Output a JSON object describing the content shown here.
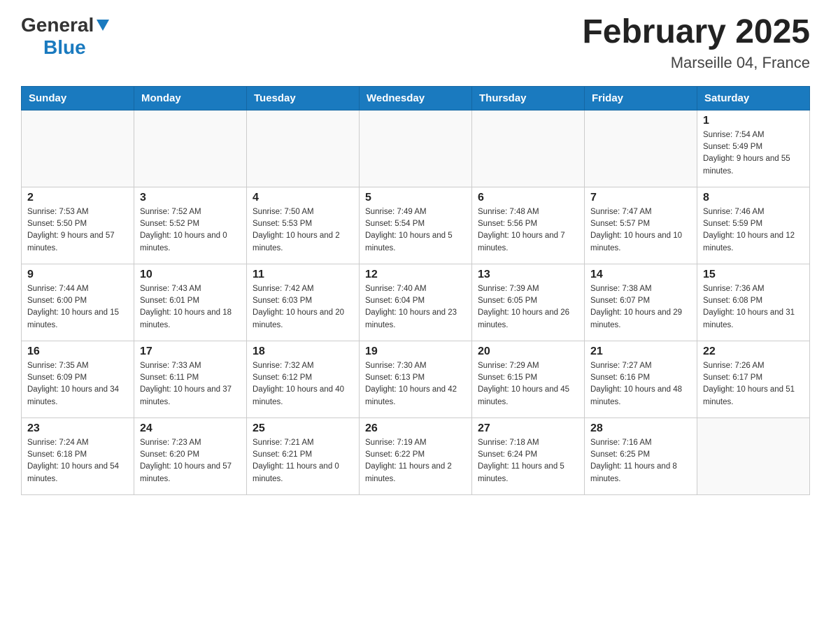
{
  "header": {
    "logo_general": "General",
    "logo_blue": "Blue",
    "month_year": "February 2025",
    "location": "Marseille 04, France"
  },
  "days_of_week": [
    "Sunday",
    "Monday",
    "Tuesday",
    "Wednesday",
    "Thursday",
    "Friday",
    "Saturday"
  ],
  "weeks": [
    [
      {
        "day": "",
        "info": ""
      },
      {
        "day": "",
        "info": ""
      },
      {
        "day": "",
        "info": ""
      },
      {
        "day": "",
        "info": ""
      },
      {
        "day": "",
        "info": ""
      },
      {
        "day": "",
        "info": ""
      },
      {
        "day": "1",
        "info": "Sunrise: 7:54 AM\nSunset: 5:49 PM\nDaylight: 9 hours and 55 minutes."
      }
    ],
    [
      {
        "day": "2",
        "info": "Sunrise: 7:53 AM\nSunset: 5:50 PM\nDaylight: 9 hours and 57 minutes."
      },
      {
        "day": "3",
        "info": "Sunrise: 7:52 AM\nSunset: 5:52 PM\nDaylight: 10 hours and 0 minutes."
      },
      {
        "day": "4",
        "info": "Sunrise: 7:50 AM\nSunset: 5:53 PM\nDaylight: 10 hours and 2 minutes."
      },
      {
        "day": "5",
        "info": "Sunrise: 7:49 AM\nSunset: 5:54 PM\nDaylight: 10 hours and 5 minutes."
      },
      {
        "day": "6",
        "info": "Sunrise: 7:48 AM\nSunset: 5:56 PM\nDaylight: 10 hours and 7 minutes."
      },
      {
        "day": "7",
        "info": "Sunrise: 7:47 AM\nSunset: 5:57 PM\nDaylight: 10 hours and 10 minutes."
      },
      {
        "day": "8",
        "info": "Sunrise: 7:46 AM\nSunset: 5:59 PM\nDaylight: 10 hours and 12 minutes."
      }
    ],
    [
      {
        "day": "9",
        "info": "Sunrise: 7:44 AM\nSunset: 6:00 PM\nDaylight: 10 hours and 15 minutes."
      },
      {
        "day": "10",
        "info": "Sunrise: 7:43 AM\nSunset: 6:01 PM\nDaylight: 10 hours and 18 minutes."
      },
      {
        "day": "11",
        "info": "Sunrise: 7:42 AM\nSunset: 6:03 PM\nDaylight: 10 hours and 20 minutes."
      },
      {
        "day": "12",
        "info": "Sunrise: 7:40 AM\nSunset: 6:04 PM\nDaylight: 10 hours and 23 minutes."
      },
      {
        "day": "13",
        "info": "Sunrise: 7:39 AM\nSunset: 6:05 PM\nDaylight: 10 hours and 26 minutes."
      },
      {
        "day": "14",
        "info": "Sunrise: 7:38 AM\nSunset: 6:07 PM\nDaylight: 10 hours and 29 minutes."
      },
      {
        "day": "15",
        "info": "Sunrise: 7:36 AM\nSunset: 6:08 PM\nDaylight: 10 hours and 31 minutes."
      }
    ],
    [
      {
        "day": "16",
        "info": "Sunrise: 7:35 AM\nSunset: 6:09 PM\nDaylight: 10 hours and 34 minutes."
      },
      {
        "day": "17",
        "info": "Sunrise: 7:33 AM\nSunset: 6:11 PM\nDaylight: 10 hours and 37 minutes."
      },
      {
        "day": "18",
        "info": "Sunrise: 7:32 AM\nSunset: 6:12 PM\nDaylight: 10 hours and 40 minutes."
      },
      {
        "day": "19",
        "info": "Sunrise: 7:30 AM\nSunset: 6:13 PM\nDaylight: 10 hours and 42 minutes."
      },
      {
        "day": "20",
        "info": "Sunrise: 7:29 AM\nSunset: 6:15 PM\nDaylight: 10 hours and 45 minutes."
      },
      {
        "day": "21",
        "info": "Sunrise: 7:27 AM\nSunset: 6:16 PM\nDaylight: 10 hours and 48 minutes."
      },
      {
        "day": "22",
        "info": "Sunrise: 7:26 AM\nSunset: 6:17 PM\nDaylight: 10 hours and 51 minutes."
      }
    ],
    [
      {
        "day": "23",
        "info": "Sunrise: 7:24 AM\nSunset: 6:18 PM\nDaylight: 10 hours and 54 minutes."
      },
      {
        "day": "24",
        "info": "Sunrise: 7:23 AM\nSunset: 6:20 PM\nDaylight: 10 hours and 57 minutes."
      },
      {
        "day": "25",
        "info": "Sunrise: 7:21 AM\nSunset: 6:21 PM\nDaylight: 11 hours and 0 minutes."
      },
      {
        "day": "26",
        "info": "Sunrise: 7:19 AM\nSunset: 6:22 PM\nDaylight: 11 hours and 2 minutes."
      },
      {
        "day": "27",
        "info": "Sunrise: 7:18 AM\nSunset: 6:24 PM\nDaylight: 11 hours and 5 minutes."
      },
      {
        "day": "28",
        "info": "Sunrise: 7:16 AM\nSunset: 6:25 PM\nDaylight: 11 hours and 8 minutes."
      },
      {
        "day": "",
        "info": ""
      }
    ]
  ]
}
